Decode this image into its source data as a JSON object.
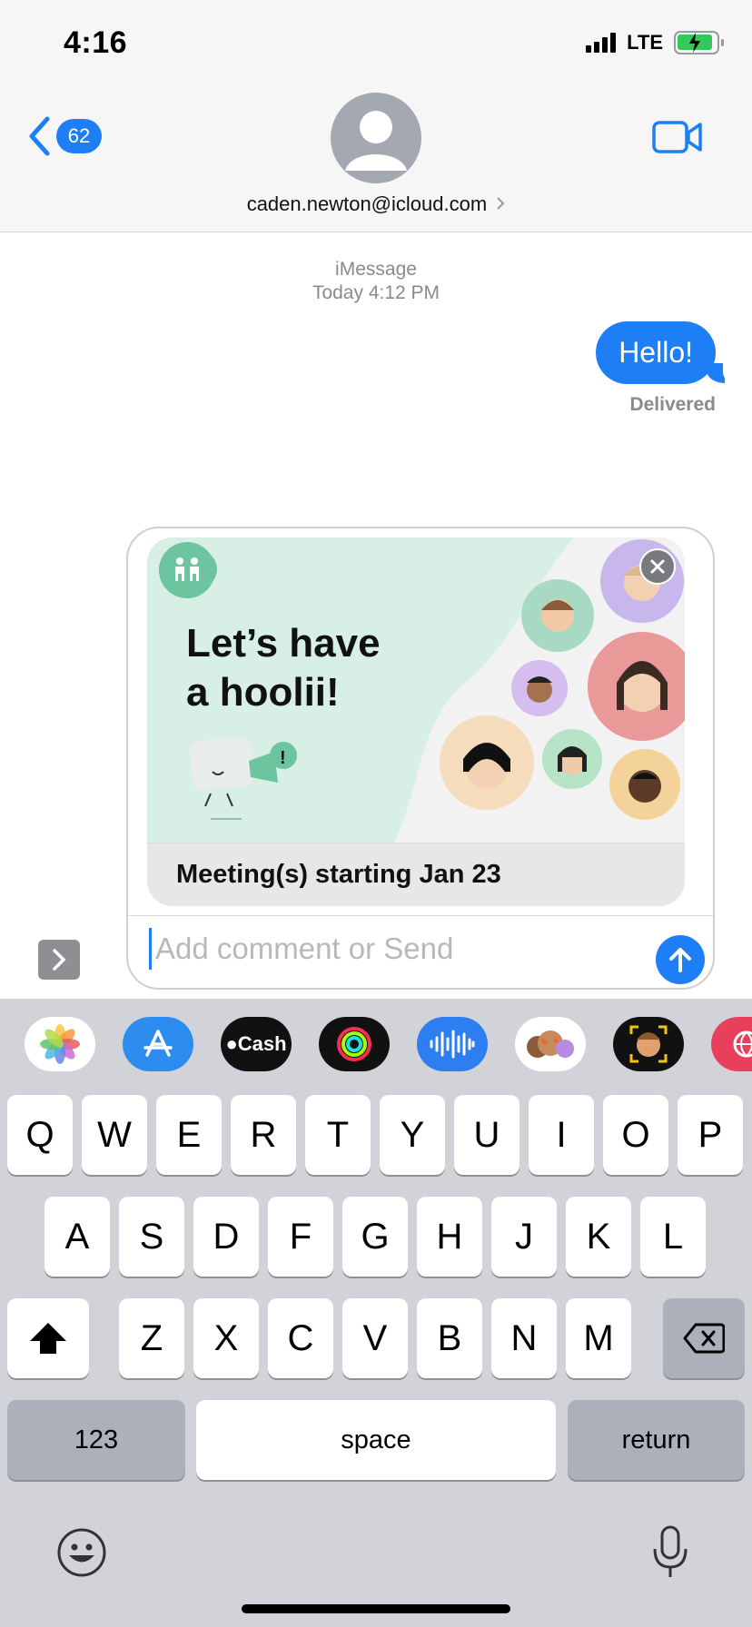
{
  "status": {
    "time": "4:16",
    "network": "LTE",
    "battery_percent": 0.8
  },
  "header": {
    "back_count": "62",
    "contact": "caden.newton@icloud.com"
  },
  "conversation": {
    "service": "iMessage",
    "timestamp": "Today 4:12 PM",
    "messages": [
      {
        "from": "me",
        "text": "Hello!"
      }
    ],
    "delivery_status": "Delivered"
  },
  "card": {
    "headline_line1": "Let’s have",
    "headline_line2_prefix": "a",
    "headline_highlight": "hoolii!",
    "footer": "Meeting(s) starting Jan 23"
  },
  "compose": {
    "placeholder": "Add comment or Send"
  },
  "app_strip": [
    "photos-icon",
    "app-store-icon",
    "apple-cash-icon",
    "activity-icon",
    "audio-message-icon",
    "memoji-stickers-icon",
    "animoji-icon",
    "web-search-icon"
  ],
  "app_strip_labels": {
    "cash": "Cash"
  },
  "keyboard": {
    "row1": [
      "Q",
      "W",
      "E",
      "R",
      "T",
      "Y",
      "U",
      "I",
      "O",
      "P"
    ],
    "row2": [
      "A",
      "S",
      "D",
      "F",
      "G",
      "H",
      "J",
      "K",
      "L"
    ],
    "row3": [
      "Z",
      "X",
      "C",
      "V",
      "B",
      "N",
      "M"
    ],
    "numbers": "123",
    "space": "space",
    "return": "return"
  },
  "colors": {
    "accent": "#1e7ef5",
    "card_bg": "#d8efe6",
    "keyboard_bg": "#d1d3d9"
  }
}
